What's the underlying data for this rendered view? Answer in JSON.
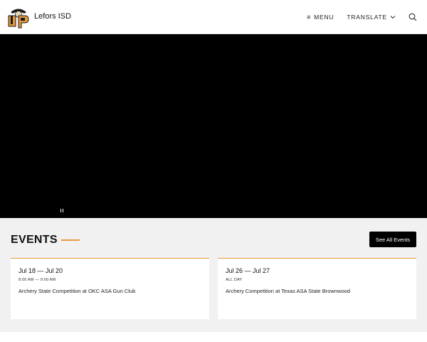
{
  "header": {
    "site_name": "Lefors ISD",
    "menu_label": "MENU",
    "translate_label": "TRANSLATE"
  },
  "events": {
    "title": "EVENTS",
    "see_all_label": "See All Events",
    "items": [
      {
        "date": "Jul 18 — Jul 20",
        "time": "8:00 AM — 9:00 AM",
        "title": "Archery State Competition at OKC ASA Gun Club"
      },
      {
        "date": "Jul 26 — Jul 27",
        "time": "ALL DAY",
        "title": "Archery Competition at Texas ASA State Brownwood"
      }
    ]
  },
  "colors": {
    "accent": "#e79a3c",
    "hero_bg": "#000000",
    "section_bg": "#f1f1f1"
  }
}
